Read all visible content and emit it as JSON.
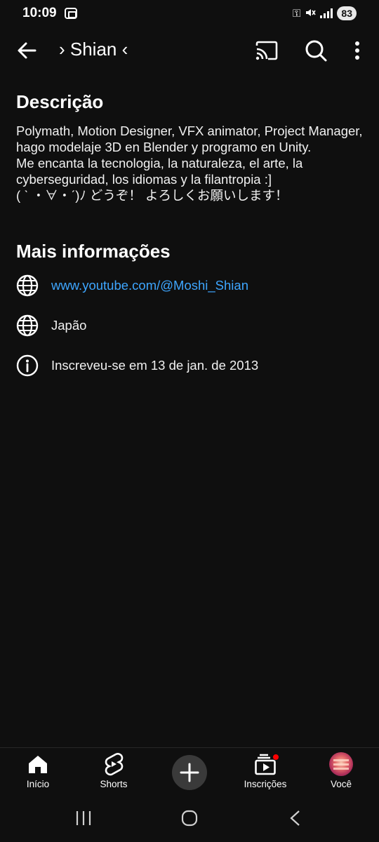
{
  "status_bar": {
    "time": "10:09",
    "battery": "83"
  },
  "app_bar": {
    "title": "› Shian ‹",
    "icons": [
      "back-arrow-icon",
      "cast-icon",
      "search-icon",
      "more-vert-icon"
    ]
  },
  "description": {
    "heading": "Descrição",
    "lines": [
      "Polymath, Motion Designer, VFX animator, Project Manager, hago modelaje 3D en Blender y programo en Unity.",
      "Me encanta la tecnologia, la naturaleza, el arte, la cyberseguridad, los idiomas y la filantropia :]",
      "( ˋ ・∀・ˊ)ﾉ どうぞ！ よろしくお願いします！"
    ]
  },
  "more_info": {
    "heading": "Mais informações",
    "items": [
      {
        "icon": "globe-icon",
        "text": "www.youtube.com/@Moshi_Shian",
        "is_link": true
      },
      {
        "icon": "globe-icon",
        "text": "Japão",
        "is_link": false
      },
      {
        "icon": "info-icon",
        "text": "Inscreveu-se em 13 de jan. de 2013",
        "is_link": false
      }
    ]
  },
  "bottom_nav": {
    "items": [
      {
        "label": "Início",
        "icon": "home-icon"
      },
      {
        "label": "Shorts",
        "icon": "shorts-icon"
      },
      {
        "label": "",
        "icon": "plus-icon"
      },
      {
        "label": "Inscrições",
        "icon": "subscriptions-icon"
      },
      {
        "label": "Você",
        "icon": "avatar"
      }
    ]
  },
  "colors": {
    "background": "#0f0f0f",
    "text": "#f1f1f1",
    "link": "#3ea6ff",
    "notification": "#ff0000"
  }
}
